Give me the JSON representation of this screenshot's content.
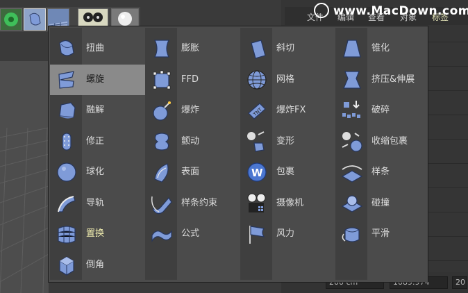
{
  "watermark": "www.MacDown.com",
  "menu_bar": [
    {
      "label": "文件",
      "active": false
    },
    {
      "label": "编辑",
      "active": false
    },
    {
      "label": "查看",
      "active": false
    },
    {
      "label": "对象",
      "active": false
    },
    {
      "label": "标签",
      "active": true
    }
  ],
  "fields": {
    "size": "200 cm",
    "value": "1089.974",
    "third": "20"
  },
  "colors": {
    "menu_bg": "#4b4b4b",
    "selected_bg": "#8a8a8a",
    "icon_blue": "#7f9bd8",
    "highlight_text": "#f2efb0"
  },
  "deformers": [
    [
      {
        "label": "扭曲",
        "icon": "twist-icon"
      },
      {
        "label": "螺旋",
        "icon": "spiral-icon",
        "selected": true
      },
      {
        "label": "融解",
        "icon": "melt-icon"
      },
      {
        "label": "修正",
        "icon": "correction-icon"
      },
      {
        "label": "球化",
        "icon": "spherify-icon"
      },
      {
        "label": "导轨",
        "icon": "rail-icon"
      },
      {
        "label": "置换",
        "icon": "displacer-icon",
        "highlight": true
      },
      {
        "label": "倒角",
        "icon": "bevel-icon"
      }
    ],
    [
      {
        "label": "膨胀",
        "icon": "bulge-icon"
      },
      {
        "label": "FFD",
        "icon": "ffd-icon"
      },
      {
        "label": "爆炸",
        "icon": "explosion-icon"
      },
      {
        "label": "颤动",
        "icon": "jiggle-icon"
      },
      {
        "label": "表面",
        "icon": "surface-icon"
      },
      {
        "label": "样条约束",
        "icon": "spline-wrap-icon"
      },
      {
        "label": "公式",
        "icon": "formula-icon"
      }
    ],
    [
      {
        "label": "斜切",
        "icon": "shear-icon"
      },
      {
        "label": "网格",
        "icon": "mesh-icon"
      },
      {
        "label": "爆炸FX",
        "icon": "explosion-fx-icon"
      },
      {
        "label": "变形",
        "icon": "morph-icon"
      },
      {
        "label": "包裹",
        "icon": "wrap-icon"
      },
      {
        "label": "摄像机",
        "icon": "camera-icon"
      },
      {
        "label": "风力",
        "icon": "wind-icon"
      }
    ],
    [
      {
        "label": "锥化",
        "icon": "taper-icon"
      },
      {
        "label": "挤压&伸展",
        "icon": "squash-stretch-icon"
      },
      {
        "label": "破碎",
        "icon": "shatter-icon"
      },
      {
        "label": "收缩包裹",
        "icon": "shrink-wrap-icon"
      },
      {
        "label": "样条",
        "icon": "spline-icon"
      },
      {
        "label": "碰撞",
        "icon": "collision-icon"
      },
      {
        "label": "平滑",
        "icon": "smoothing-icon"
      }
    ]
  ]
}
